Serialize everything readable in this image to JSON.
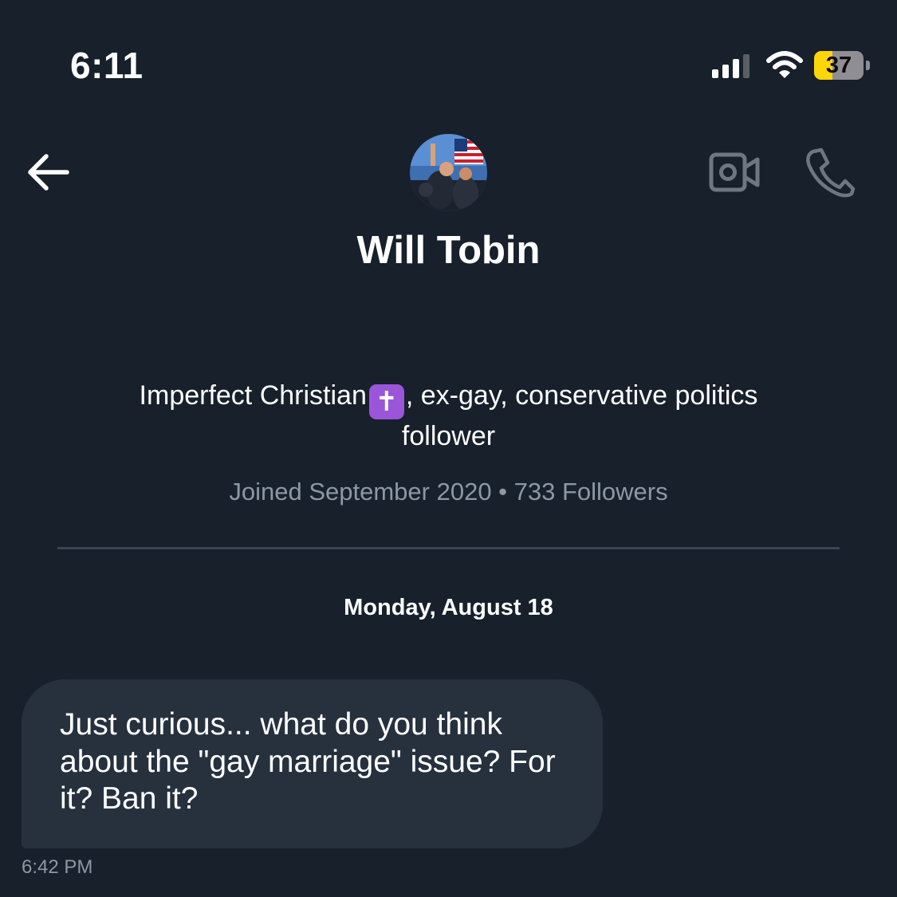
{
  "status_bar": {
    "time": "6:11",
    "battery_level": "37",
    "battery_fraction": 0.37,
    "signal_bars_active": 3,
    "signal_bars_total": 4
  },
  "header": {
    "back_icon": "arrow-left-icon",
    "video_icon": "video-camera-icon",
    "phone_icon": "phone-icon"
  },
  "profile": {
    "name": "Will Tobin",
    "bio_before_emoji": "Imperfect Christian",
    "bio_emoji": "✝",
    "bio_after_emoji": ", ex-gay, conservative politics follower",
    "meta": "Joined September 2020 • 733 Followers"
  },
  "conversation": {
    "date_label": "Monday, August 18",
    "messages": [
      {
        "text": "Just curious... what do you think about the \"gay marriage\" issue? For it? Ban it?",
        "time": "6:42 PM",
        "direction": "incoming"
      }
    ]
  },
  "colors": {
    "background": "#17202b",
    "bubble": "#27313e",
    "secondary_text": "#8b98a5",
    "icon_muted": "#6e7781",
    "battery_low": "#ffd60a",
    "cross_emoji_bg": "#9a55d9"
  }
}
